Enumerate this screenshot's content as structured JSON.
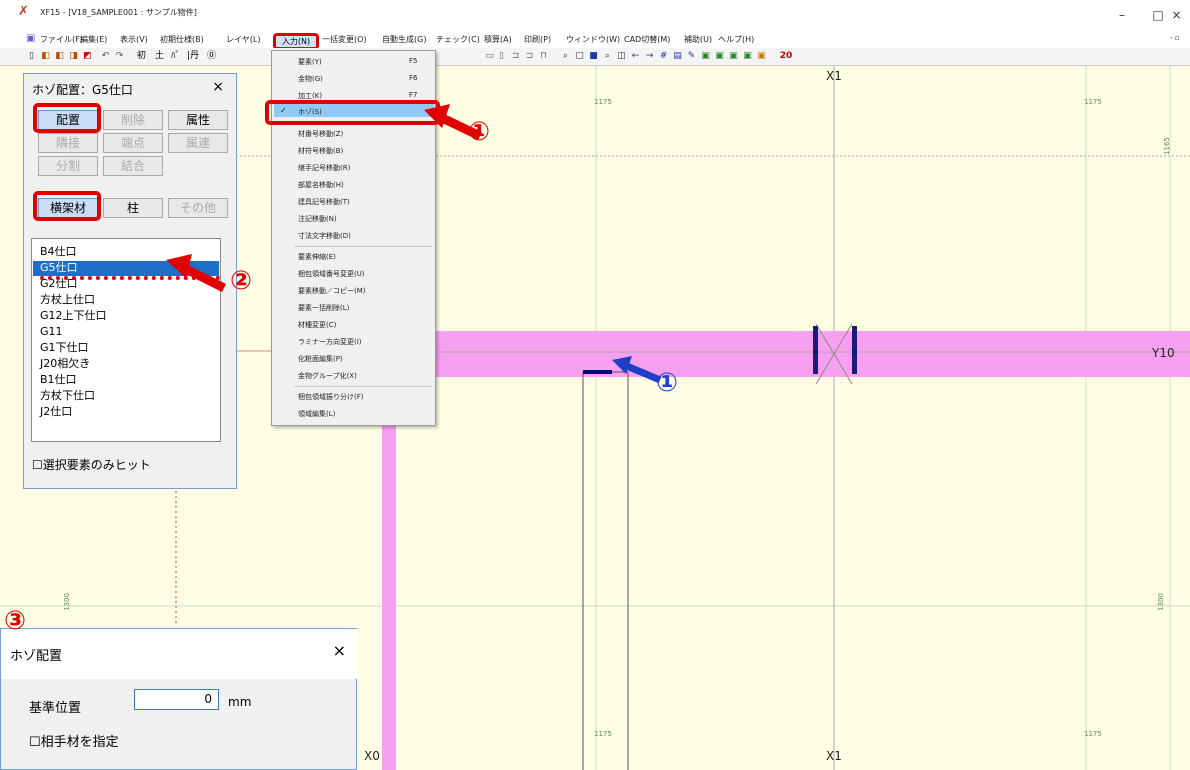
{
  "window": {
    "title": "XF15 - [V18_SAMPLE001 : サンプル物件]",
    "app_icon": "xf-logo-icon",
    "minimize": "–",
    "maximize": "□",
    "close": "×"
  },
  "menubar": {
    "items": [
      "ファイル(F)",
      "編集(E)",
      "表示(V)",
      "初期仕様(B)",
      "レイヤ(L)",
      "入力(N)",
      "一括変更(O)",
      "自動生成(G)",
      "チェック(C)",
      "積算(A)",
      "印刷(P)",
      "ウィンドウ(W)",
      "CAD切替(M)",
      "補助(U)",
      "ヘルプ(H)"
    ]
  },
  "toolbar": {
    "texts": [
      "初",
      "土",
      "ﾊﾟ",
      "|丹",
      "⓪"
    ],
    "number": "20"
  },
  "dropdown": {
    "items": [
      {
        "label": "要素(Y)",
        "key": "F5"
      },
      {
        "label": "金物(G)",
        "key": "F6"
      },
      {
        "label": "加工(K)",
        "key": "F7"
      },
      {
        "label": "ホゾ(S)",
        "key": ""
      },
      {
        "label": "材番号移動(Z)",
        "key": ""
      },
      {
        "label": "材符号移動(B)",
        "key": ""
      },
      {
        "label": "継手記号移動(R)",
        "key": ""
      },
      {
        "label": "部屋名移動(H)",
        "key": ""
      },
      {
        "label": "建具記号移動(T)",
        "key": ""
      },
      {
        "label": "注記移動(N)",
        "key": ""
      },
      {
        "label": "寸法文字移動(D)",
        "key": ""
      },
      {
        "label": "要素伸縮(E)",
        "key": ""
      },
      {
        "label": "梱包領域番号変更(U)",
        "key": ""
      },
      {
        "label": "要素移動／コピー(M)",
        "key": ""
      },
      {
        "label": "要素一括削除(L)",
        "key": ""
      },
      {
        "label": "材種変更(C)",
        "key": ""
      },
      {
        "label": "ラミナー方向変更(I)",
        "key": ""
      },
      {
        "label": "化粧面編集(P)",
        "key": ""
      },
      {
        "label": "金物グループ化(X)",
        "key": ""
      },
      {
        "label": "梱包領域振り分け(F)",
        "key": ""
      },
      {
        "label": "領域編集(L)",
        "key": ""
      }
    ],
    "checked_mark": "✓"
  },
  "panel": {
    "title": "ホゾ配置：G5仕口",
    "close": "×",
    "buttons": [
      "配置",
      "削除",
      "属性",
      "隣接",
      "端点",
      "属連",
      "分割",
      "結合"
    ],
    "tabs": [
      "横架材",
      "柱",
      "その他"
    ],
    "list": [
      "B4仕口",
      "G5仕口",
      "G2仕口",
      "方杖上仕口",
      "G12上下仕口",
      "G11",
      "G1下仕口",
      "J20相欠き",
      "B1仕口",
      "方杖下仕口",
      "J2仕口"
    ],
    "selected_index": 1,
    "checkbox_label": "選択要素のみヒット"
  },
  "dialog": {
    "title": "ホゾ配置",
    "close": "×",
    "ref_label": "基準位置",
    "ref_value": "0",
    "unit": "mm",
    "checkbox_label": "相手材を指定"
  },
  "canvas": {
    "axes": {
      "x1_top": "X1",
      "x1_bottom": "X1",
      "x0_bottom": "X0",
      "y10": "Y10"
    },
    "dims": {
      "top_a": "1175",
      "top_b": "1175",
      "right_top": "1165",
      "left_mid": "1300",
      "right_mid": "1300",
      "bot_a": "1175",
      "bot_b": "1175"
    }
  },
  "annotations": {
    "marker1": "①",
    "marker2": "②",
    "marker3": "③"
  },
  "colors": {
    "accent_red": "#e00000",
    "canvas_bg": "#fdfee3",
    "beam_pink": "#f7a0f0",
    "selection_blue": "#1e6fc9",
    "arrow_blue": "#1e40c8"
  }
}
